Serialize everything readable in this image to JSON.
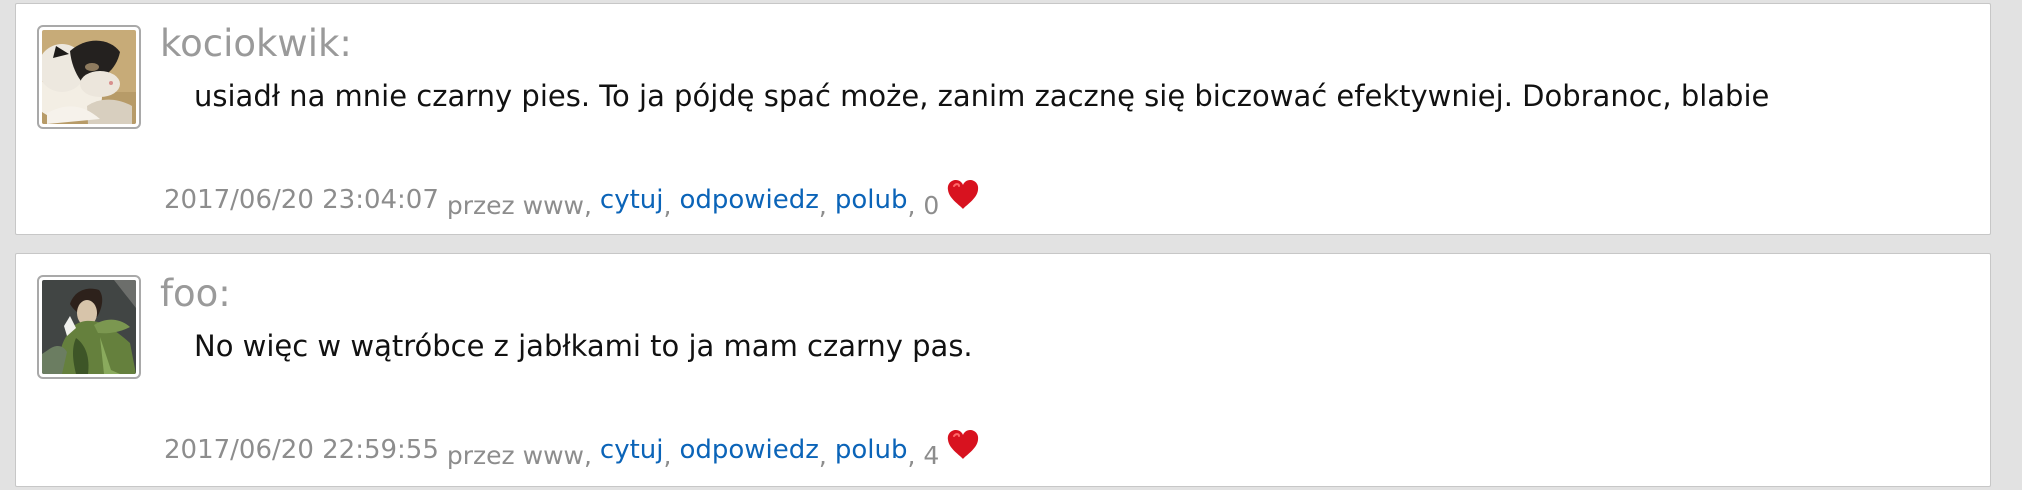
{
  "posts": [
    {
      "author": "kociokwik:",
      "avatar_icon": "cat-avatar-icon",
      "text": "usiadł na mnie czarny pies. To ja pójdę spać może, zanim zacznę się biczować efektywniej. Dobranoc, blabie",
      "timestamp": "2017/06/20 23:04:07",
      "via": "przez www,",
      "actions": {
        "quote": "cytuj",
        "reply": "odpowiedz",
        "like": "polub"
      },
      "separator": ",",
      "like_count": ", 0",
      "heart_icon": "heart-icon"
    },
    {
      "author": "foo:",
      "avatar_icon": "woman-in-green-avatar-icon",
      "text": "No więc w wątróbce z jabłkami to ja mam czarny pas.",
      "timestamp": "2017/06/20 22:59:55",
      "via": "przez www,",
      "actions": {
        "quote": "cytuj",
        "reply": "odpowiedz",
        "like": "polub"
      },
      "separator": ",",
      "like_count": ", 4",
      "heart_icon": "heart-icon"
    }
  ],
  "colors": {
    "page_background": "#e2e2e2",
    "card_background": "#ffffff",
    "author": "#9a9a9a",
    "link": "#0b64b8",
    "heart": "#d8121f"
  }
}
